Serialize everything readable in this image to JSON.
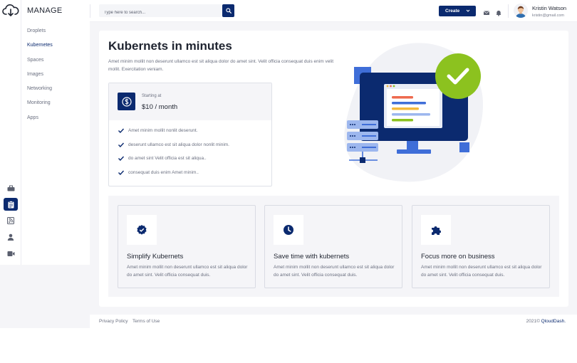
{
  "colors": {
    "primary": "#0b2a6f",
    "accent_green": "#8cc21f",
    "page_bg": "#f5f5f8"
  },
  "app": {
    "brand": "MANAGE",
    "logo_icon": "cloud-download-icon"
  },
  "rail": [
    {
      "name": "rail-briefcase",
      "icon": "briefcase-icon"
    },
    {
      "name": "rail-clipboard",
      "icon": "clipboard-icon",
      "active": true
    },
    {
      "name": "rail-feed",
      "icon": "feed-icon"
    },
    {
      "name": "rail-user",
      "icon": "user-icon"
    },
    {
      "name": "rail-video",
      "icon": "video-icon"
    }
  ],
  "sidebar": {
    "items": [
      {
        "label": "Droplets"
      },
      {
        "label": "Kubernetes",
        "active": true
      },
      {
        "label": "Spaces"
      },
      {
        "label": "Images"
      },
      {
        "label": "Networking"
      },
      {
        "label": "Monitoring"
      },
      {
        "label": "Apps"
      }
    ]
  },
  "topbar": {
    "search_placeholder": "Type here to search...",
    "create_label": "Create",
    "user_name": "Kristin Watson",
    "user_email": "kristin@gmail.com"
  },
  "hero": {
    "title": "Kubernets in minutes",
    "description": "Amet minim mollit non deserunt ullamco est sit aliqua dolor do amet sint. Velit officia consequat duis enim velit mollit. Exercitation veniam."
  },
  "pricing": {
    "starting_label": "Starting at",
    "price": "$10 / month",
    "features": [
      "Amet minim mollit nonlit deserunt.",
      "deserunt ullamco est sit aliqua dolor nonlit minim.",
      "do amet sint Velit officia est sit aliqua..",
      "consequat duis enim Amet minim.."
    ]
  },
  "feature_cards": [
    {
      "icon": "badge-check-icon",
      "title": "Simplify Kubernets",
      "description": "Amet minim mollit non deserunt ullamco est sit aliqua dolor do amet sint. Velit officia consequat duis."
    },
    {
      "icon": "clock-icon",
      "title": "Save time with kubernets",
      "description": "Amet minim mollit non deserunt ullamco est sit aliqua dolor do amet sint. Velit officia consequat duis."
    },
    {
      "icon": "puzzle-icon",
      "title": "Focus more on business",
      "description": "Amet minim mollit non deserunt ullamco est sit aliqua dolor do amet sint. Velit officia consequat duis."
    }
  ],
  "footer": {
    "privacy": "Privacy Policy",
    "terms": "Terms of Use",
    "copyright": "2021©",
    "brand": "QloudDash."
  }
}
